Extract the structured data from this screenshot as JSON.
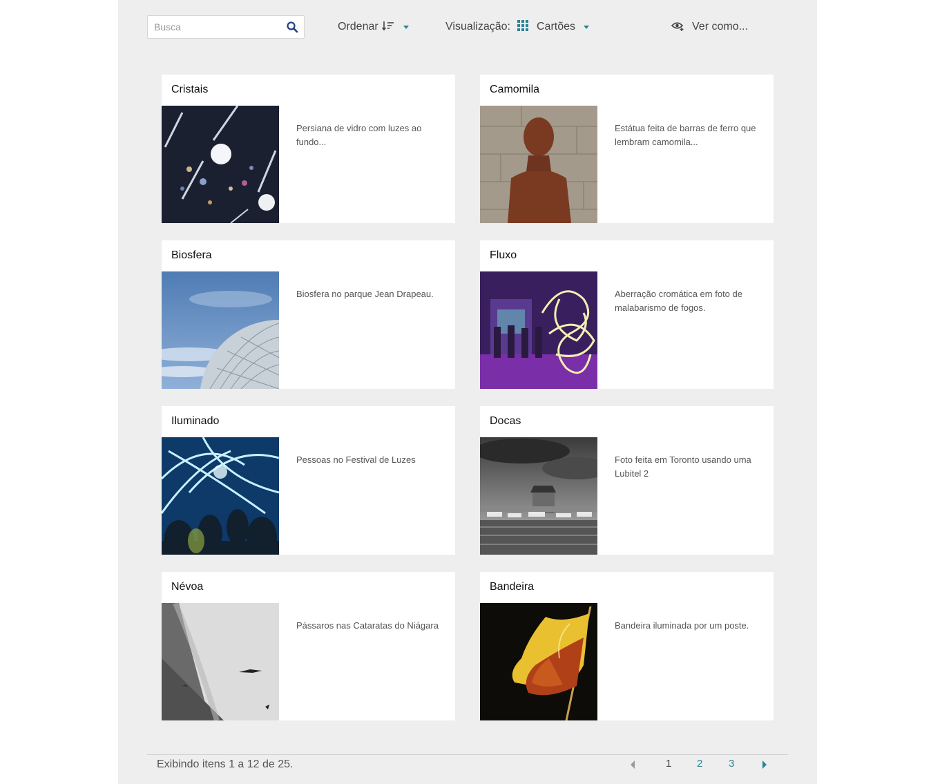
{
  "colors": {
    "accent": "#298596",
    "background": "#eeeeee",
    "card": "#ffffff"
  },
  "toolbar": {
    "search_placeholder": "Busca",
    "search_icon": "search-icon",
    "sort_label": "Ordenar",
    "sort_icon": "sort-descending-icon",
    "view_label": "Visualização:",
    "view_icon": "grid-icon",
    "view_value": "Cartões",
    "view_as_icon": "eye-plus-icon",
    "view_as_label": "Ver como..."
  },
  "items": [
    {
      "title": "Cristais",
      "description": "Persiana de vidro com luzes ao fundo..."
    },
    {
      "title": "Camomila",
      "description": "Estátua feita de barras de ferro que lembram camomila..."
    },
    {
      "title": "Biosfera",
      "description": "Biosfera no parque Jean Drapeau."
    },
    {
      "title": "Fluxo",
      "description": "Aberração cromática em foto de malabarismo de fogos."
    },
    {
      "title": "Iluminado",
      "description": "Pessoas no Festival de Luzes"
    },
    {
      "title": "Docas",
      "description": "Foto feita em Toronto usando uma Lubitel 2"
    },
    {
      "title": "Névoa",
      "description": "Pássaros nas Cataratas do Niágara"
    },
    {
      "title": "Bandeira",
      "description": "Bandeira iluminada por um poste."
    }
  ],
  "footer": {
    "info": "Exibindo itens 1 a 12 de 25.",
    "pages": [
      "1",
      "2",
      "3"
    ],
    "current_page": "1"
  }
}
